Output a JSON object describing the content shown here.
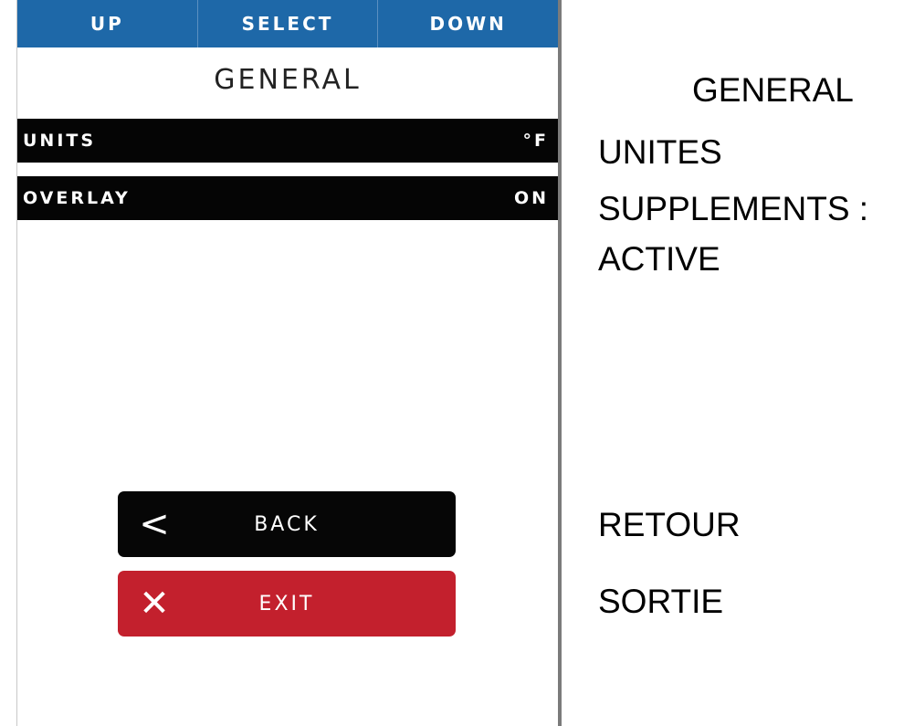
{
  "nav": {
    "up_label": "UP",
    "select_label": "SELECT",
    "down_label": "DOWN"
  },
  "screen": {
    "title": "GENERAL"
  },
  "settings": [
    {
      "label": "UNITS",
      "value": "°F"
    },
    {
      "label": "OVERLAY",
      "value": "ON"
    }
  ],
  "buttons": {
    "back": {
      "icon": "chevron-left-icon",
      "glyph": "<",
      "label": "BACK"
    },
    "exit": {
      "icon": "close-icon",
      "glyph": "✕",
      "label": "EXIT"
    }
  },
  "translations": {
    "title": "GENERAL",
    "units": "UNITES",
    "overlay_line1": "SUPPLEMENTS :",
    "overlay_line2": "ACTIVE",
    "back": "RETOUR",
    "exit": "SORTIE"
  },
  "colors": {
    "nav_blue": "#1e68a8",
    "row_black": "#050505",
    "exit_red": "#c3202d"
  }
}
